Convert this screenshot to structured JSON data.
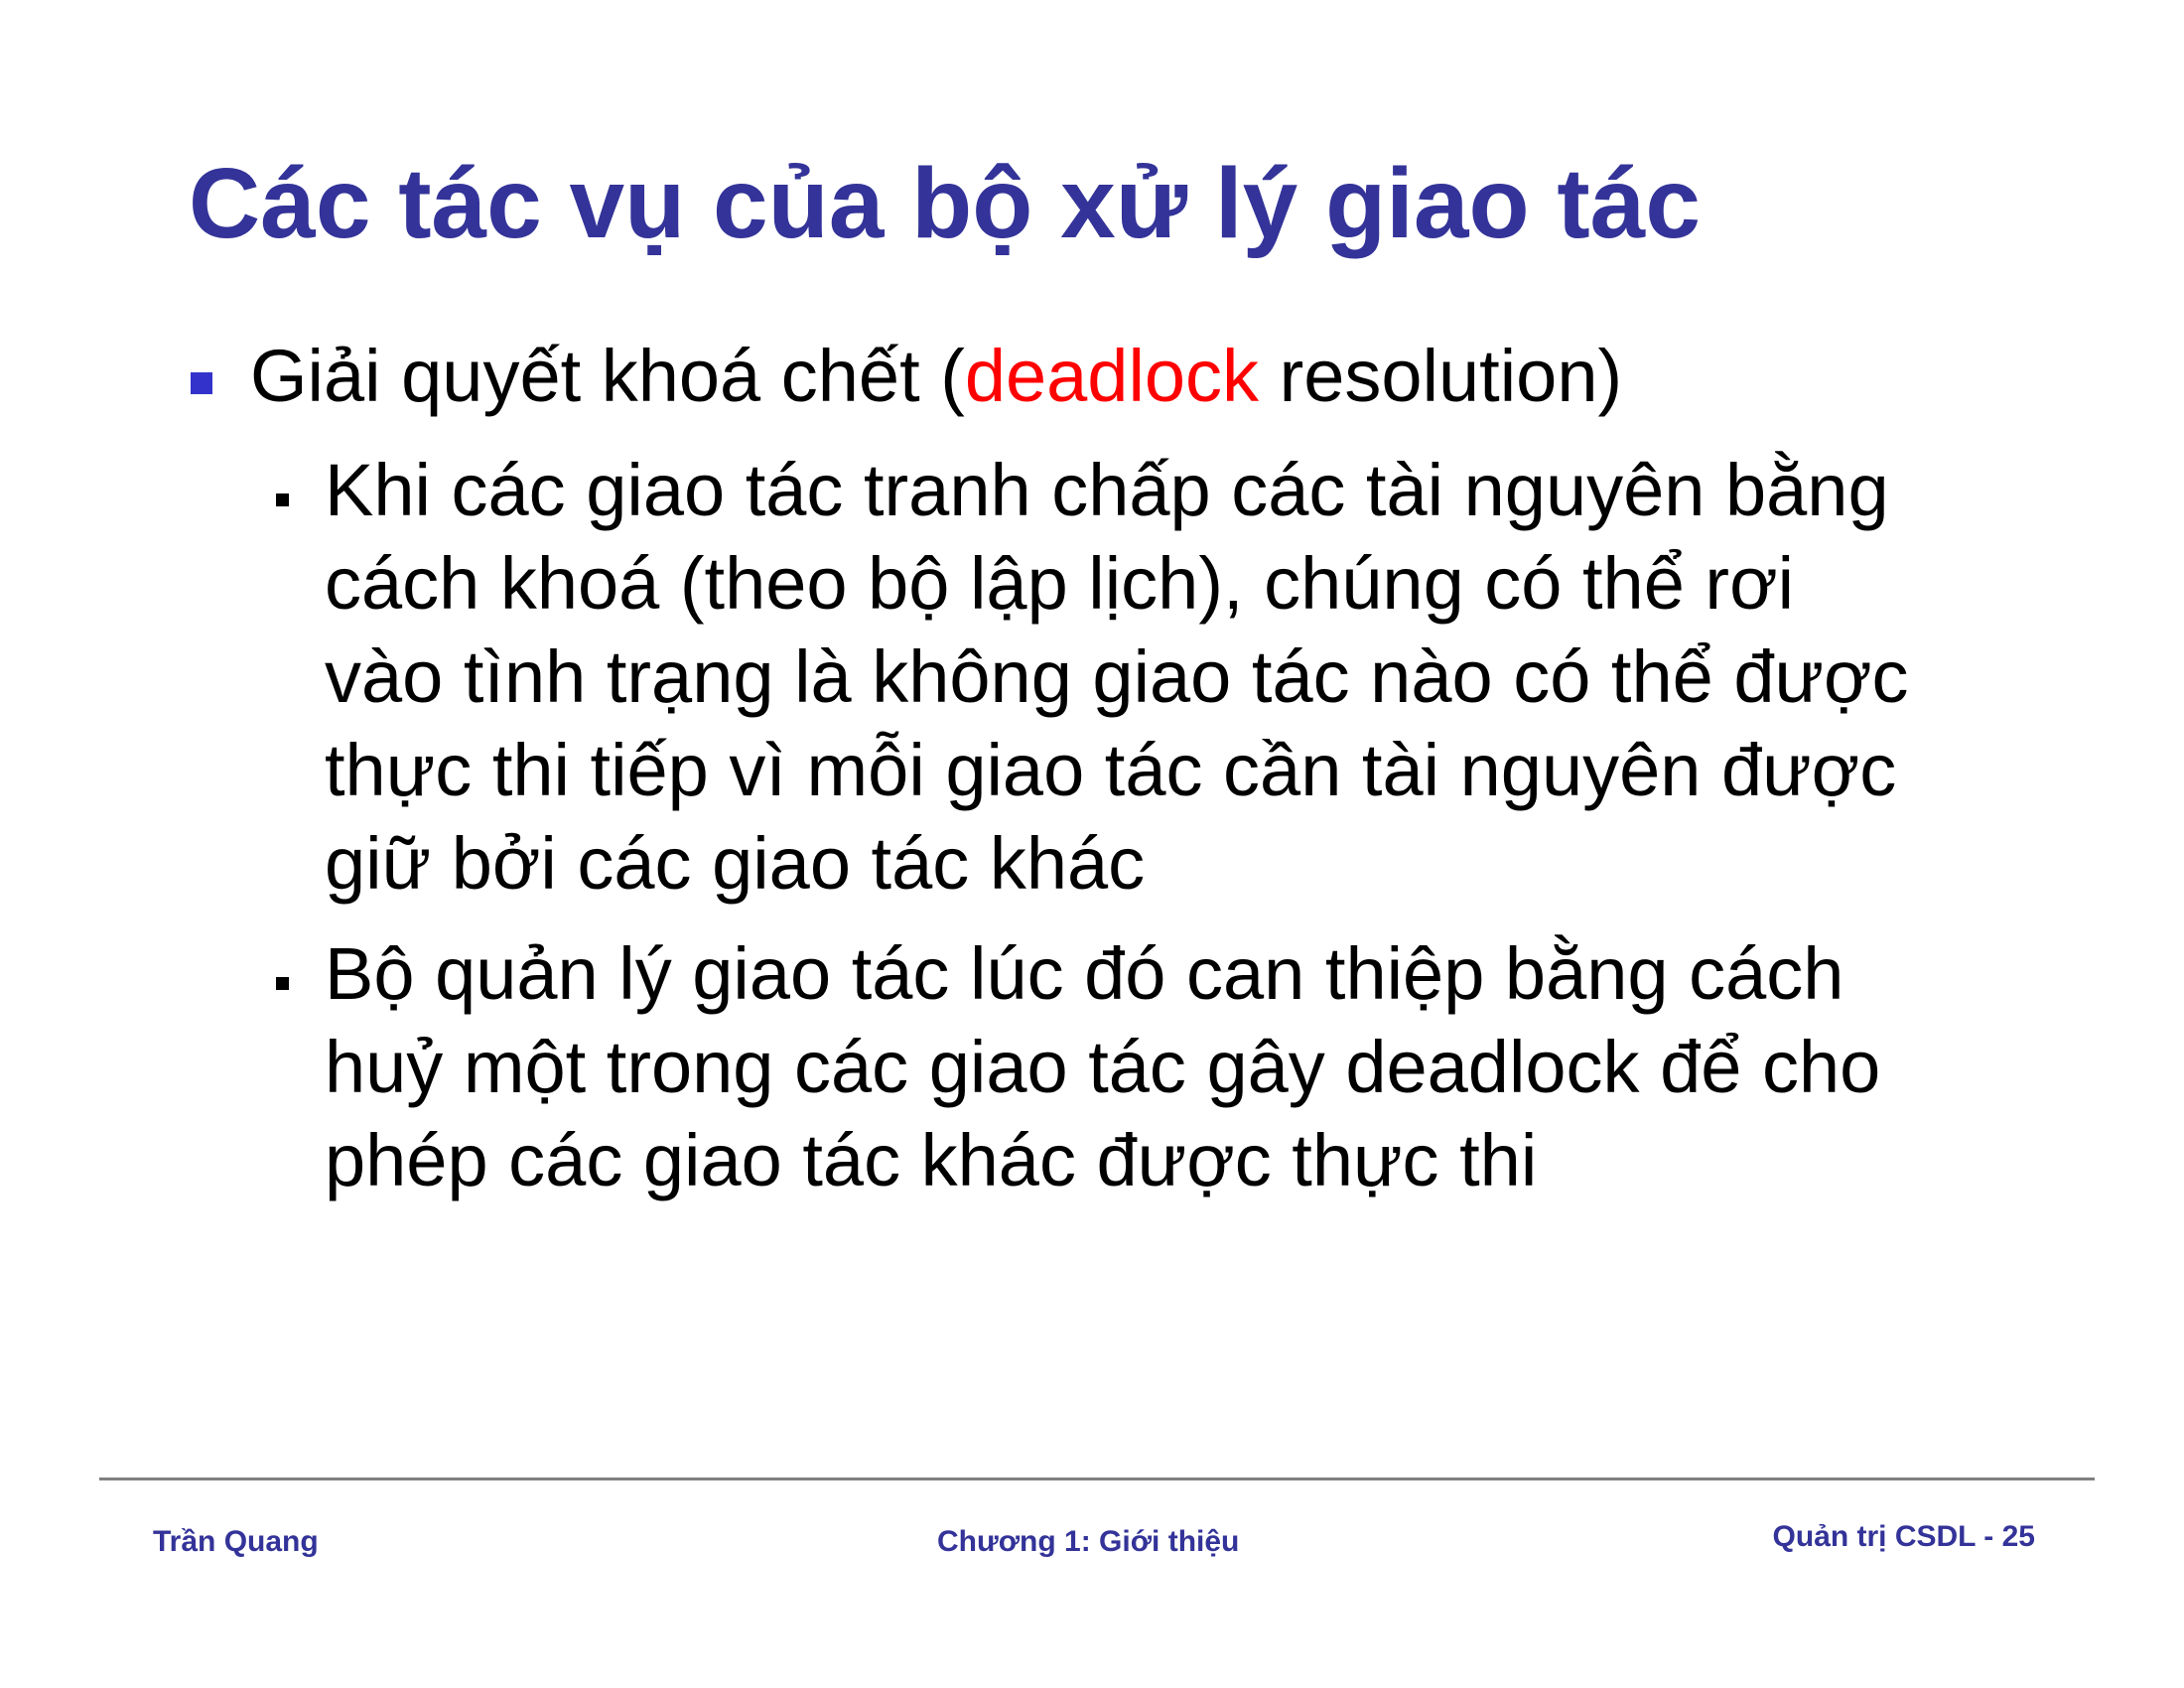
{
  "slide": {
    "title": "Các tác vụ của bộ xử lý giao tác",
    "bullet": {
      "text_before": "Giải quyết khoá chết (",
      "highlight": "deadlock",
      "text_after": " resolution)"
    },
    "sub_bullets": [
      {
        "lines": [
          "Khi các giao tác tranh chấp các tài nguyên bằng",
          "cách khoá (theo bộ lập lịch), chúng có thể rơi",
          "vào tình trạng là không giao tác nào có thể được",
          "thực thi tiếp vì mỗi giao tác cần tài nguyên được",
          "giữ bởi các giao tác khác"
        ]
      },
      {
        "lines": [
          "Bộ quản lý giao tác lúc đó can thiệp bằng cách",
          "huỷ một trong các giao tác gây deadlock để cho",
          "phép các giao tác khác được thực thi"
        ]
      }
    ]
  },
  "footer": {
    "author": "Trần Quang",
    "chapter": "Chương 1: Giới thiệu",
    "course_page": "Quản trị CSDL - 25"
  },
  "colors": {
    "title": "#333399",
    "bullet_marker": "#3333cc",
    "highlight": "#ff0000",
    "footer_text": "#333399",
    "footer_rule": "#808080"
  }
}
